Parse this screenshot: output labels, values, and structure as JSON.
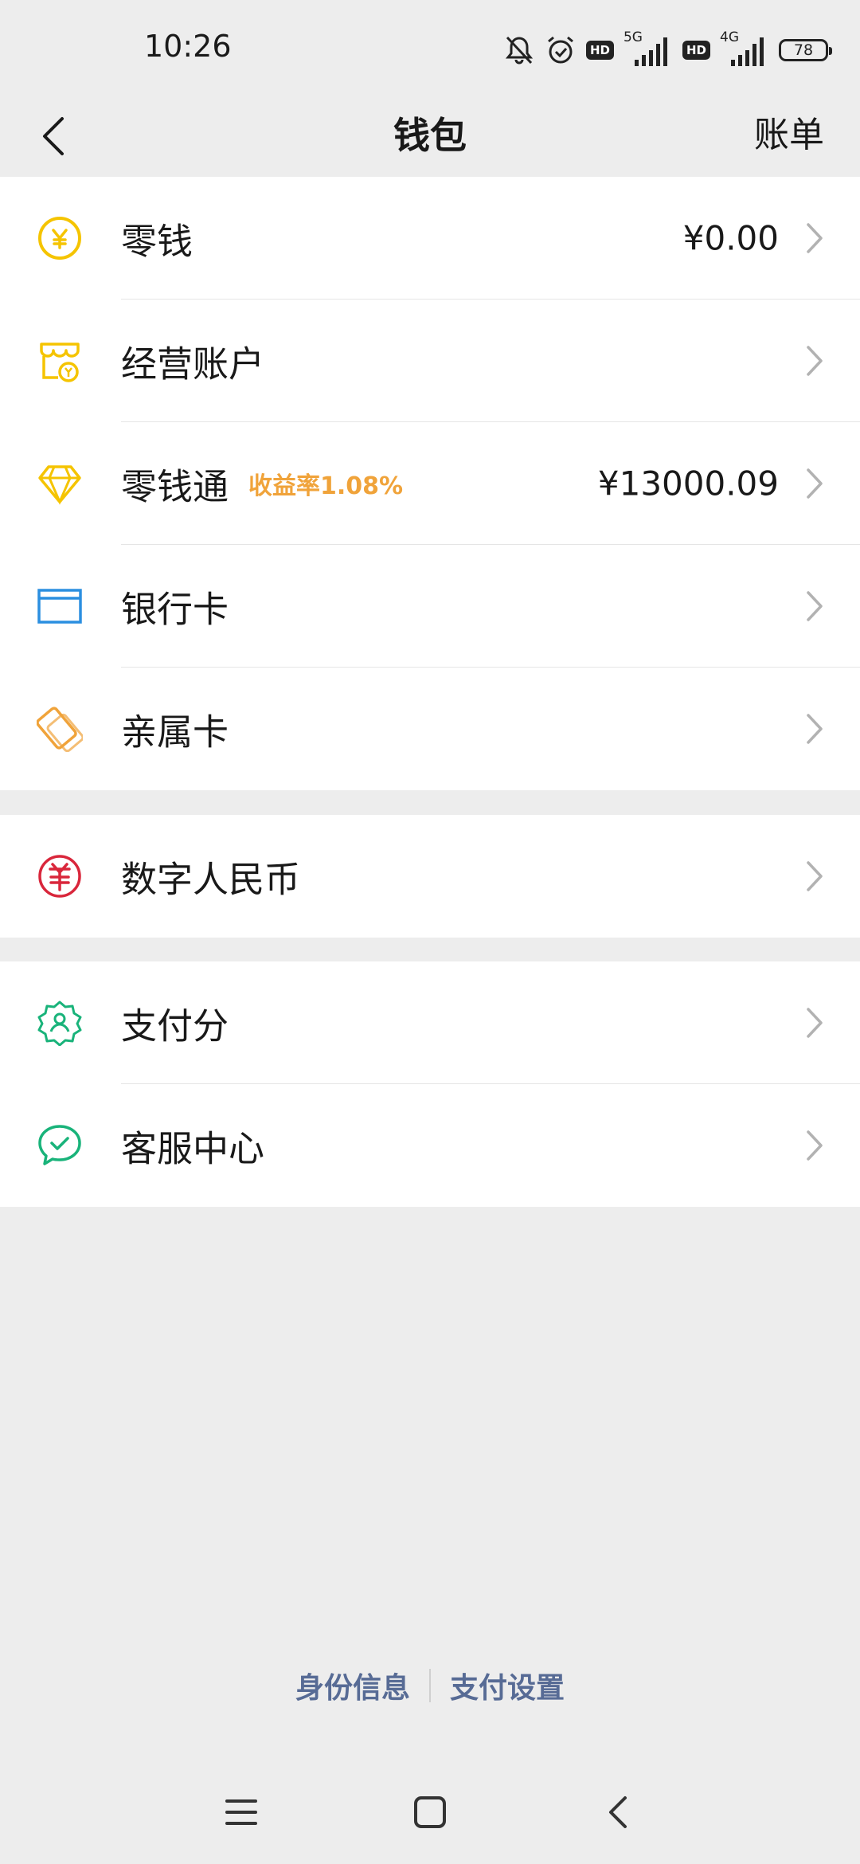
{
  "status_bar": {
    "time": "10:26",
    "net1": "5G",
    "net2": "4G",
    "hd": "HD",
    "battery": "78"
  },
  "nav": {
    "title": "钱包",
    "right_link": "账单",
    "icons": {
      "back": "back-arrow-icon"
    }
  },
  "groups": [
    {
      "items": [
        {
          "label": "零钱",
          "value": "¥0.00",
          "icon": "yuan-coin-icon",
          "color": "#f5c400"
        },
        {
          "label": "经营账户",
          "value": "",
          "icon": "shop-account-icon",
          "color": "#f5c400"
        },
        {
          "label": "零钱通",
          "badge": "收益率1.08%",
          "value": "¥13000.09",
          "icon": "diamond-icon",
          "color": "#f5c400"
        },
        {
          "label": "银行卡",
          "value": "",
          "icon": "bank-card-icon",
          "color": "#2b8fe0"
        },
        {
          "label": "亲属卡",
          "value": "",
          "icon": "family-card-icon",
          "color": "#f0a33a"
        }
      ]
    },
    {
      "items": [
        {
          "label": "数字人民币",
          "value": "",
          "icon": "digital-rmb-icon",
          "color": "#d9263b"
        }
      ]
    },
    {
      "items": [
        {
          "label": "支付分",
          "value": "",
          "icon": "pay-score-icon",
          "color": "#19b37a"
        },
        {
          "label": "客服中心",
          "value": "",
          "icon": "customer-service-icon",
          "color": "#19b37a"
        }
      ]
    }
  ],
  "footer": {
    "identity_info": "身份信息",
    "payment_settings": "支付设置"
  },
  "system_nav": {
    "icons": [
      "menu-icon",
      "home-icon",
      "back-icon"
    ]
  },
  "colors": {
    "background": "#ededed",
    "card": "#ffffff",
    "link": "#576b95",
    "badge": "#f0a33a"
  }
}
